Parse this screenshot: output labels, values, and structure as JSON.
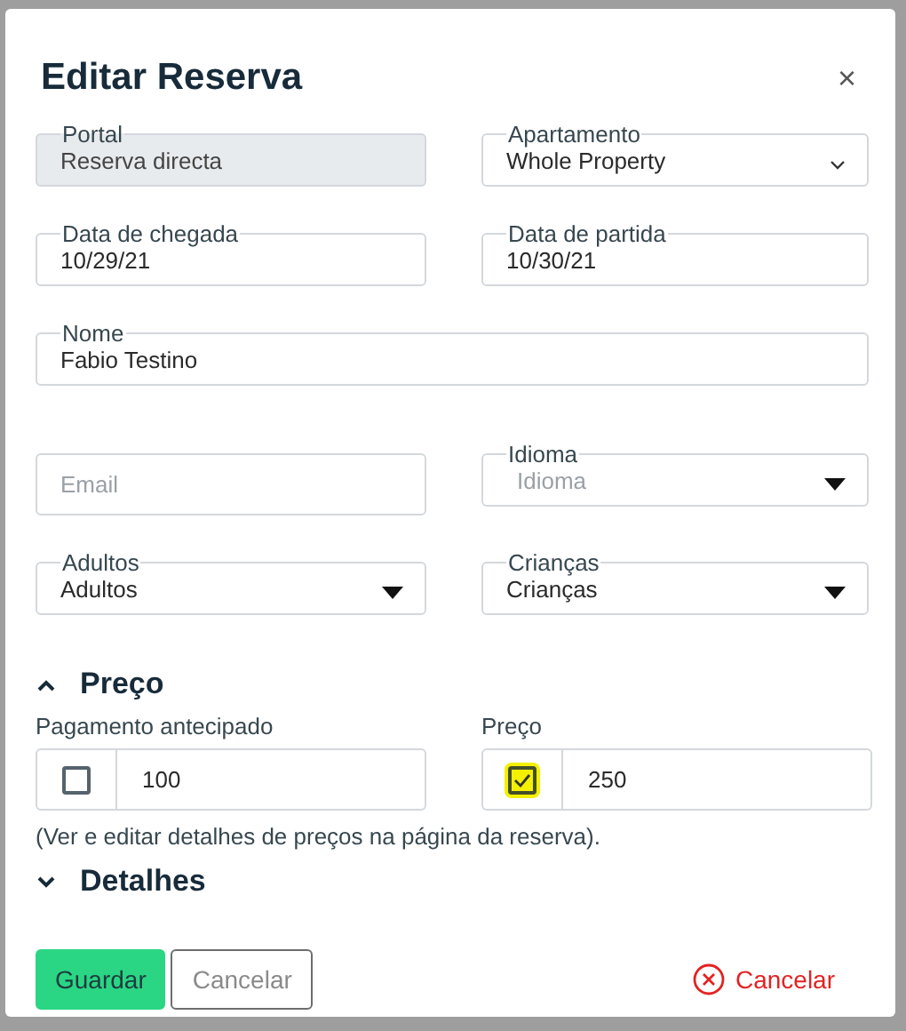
{
  "dialog": {
    "title": "Editar Reserva",
    "close": "×"
  },
  "field_rows": [
    [
      {
        "kind": "text",
        "label": "Portal",
        "value": "Reserva directa",
        "disabled": true
      },
      {
        "kind": "combo",
        "label": "Apartamento",
        "value": "Whole Property",
        "disabled": false
      }
    ],
    [
      {
        "kind": "text",
        "label": "Data de chegada",
        "value": "10/29/21",
        "disabled": false
      },
      {
        "kind": "text",
        "label": "Data de partida",
        "value": "10/30/21",
        "disabled": false
      }
    ],
    [
      {
        "kind": "text",
        "label": "Nome",
        "value": "Fabio Testino",
        "disabled": false
      }
    ],
    [
      {
        "kind": "text",
        "placeholder": "Email",
        "disabled": false
      },
      {
        "kind": "select",
        "label": "Idioma",
        "placeholder": "Idioma",
        "disabled": false
      }
    ],
    [
      {
        "kind": "select",
        "label": "Adultos",
        "value": "Adultos",
        "disabled": false
      },
      {
        "kind": "select",
        "label": "Crianças",
        "value": "Crianças",
        "disabled": false
      }
    ]
  ],
  "price_section": {
    "title": "Preço",
    "expanded": true,
    "fields": [
      {
        "label": "Pagamento antecipado",
        "checked": false,
        "value": "100"
      },
      {
        "label": "Preço",
        "checked": true,
        "value": "250"
      }
    ],
    "note": "(Ver e editar detalhes de preços na página da reserva)."
  },
  "details_section": {
    "title": "Detalhes",
    "expanded": false
  },
  "buttons": {
    "save": "Guardar",
    "cancel": "Cancelar",
    "cancel_booking": "Cancelar"
  }
}
